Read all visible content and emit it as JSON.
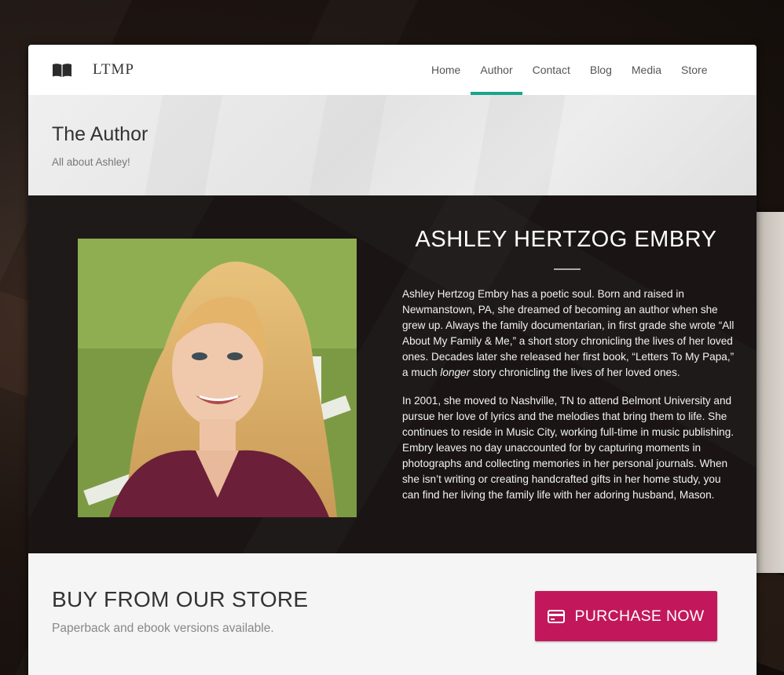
{
  "brand": {
    "name": "LTMP",
    "logo_icon": "book-icon"
  },
  "nav": {
    "items": [
      {
        "label": "Home",
        "active": false
      },
      {
        "label": "Author",
        "active": true
      },
      {
        "label": "Contact",
        "active": false
      },
      {
        "label": "Blog",
        "active": false
      },
      {
        "label": "Media",
        "active": false
      },
      {
        "label": "Store",
        "active": false
      }
    ],
    "accent_color": "#1aa58c"
  },
  "page_header": {
    "title": "The Author",
    "subtitle": "All about Ashley!"
  },
  "author": {
    "name": "ASHLEY HERTZOG EMBRY",
    "bio_p1_a": "Ashley Hertzog Embry has a poetic soul. Born and raised in Newmanstown, PA, she dreamed of becoming an author when she grew up. Always the family documentarian, in first grade she wrote “All About My Family & Me,” a short story chronicling the lives of her loved ones. Decades later she released her first book, “Letters To My Papa,” a much ",
    "bio_p1_em": "longer",
    "bio_p1_b": " story chronicling the lives of her loved ones.",
    "bio_p2": "In 2001, she moved to Nashville, TN to attend Belmont University and pursue her love of lyrics and the melodies that bring them to life. She continues to reside in Music City, working full-time in music publishing. Embry leaves no day unaccounted for by capturing moments in photographs and collecting memories in her personal journals. When she isn’t writing or creating handcrafted gifts in her home study, you can find her living the family life with her adoring husband, Mason."
  },
  "store": {
    "title": "BUY FROM OUR STORE",
    "subtitle": "Paperback and ebook versions available.",
    "button_label": "PURCHASE NOW",
    "button_icon": "credit-card-icon",
    "button_color": "#c2185b"
  }
}
